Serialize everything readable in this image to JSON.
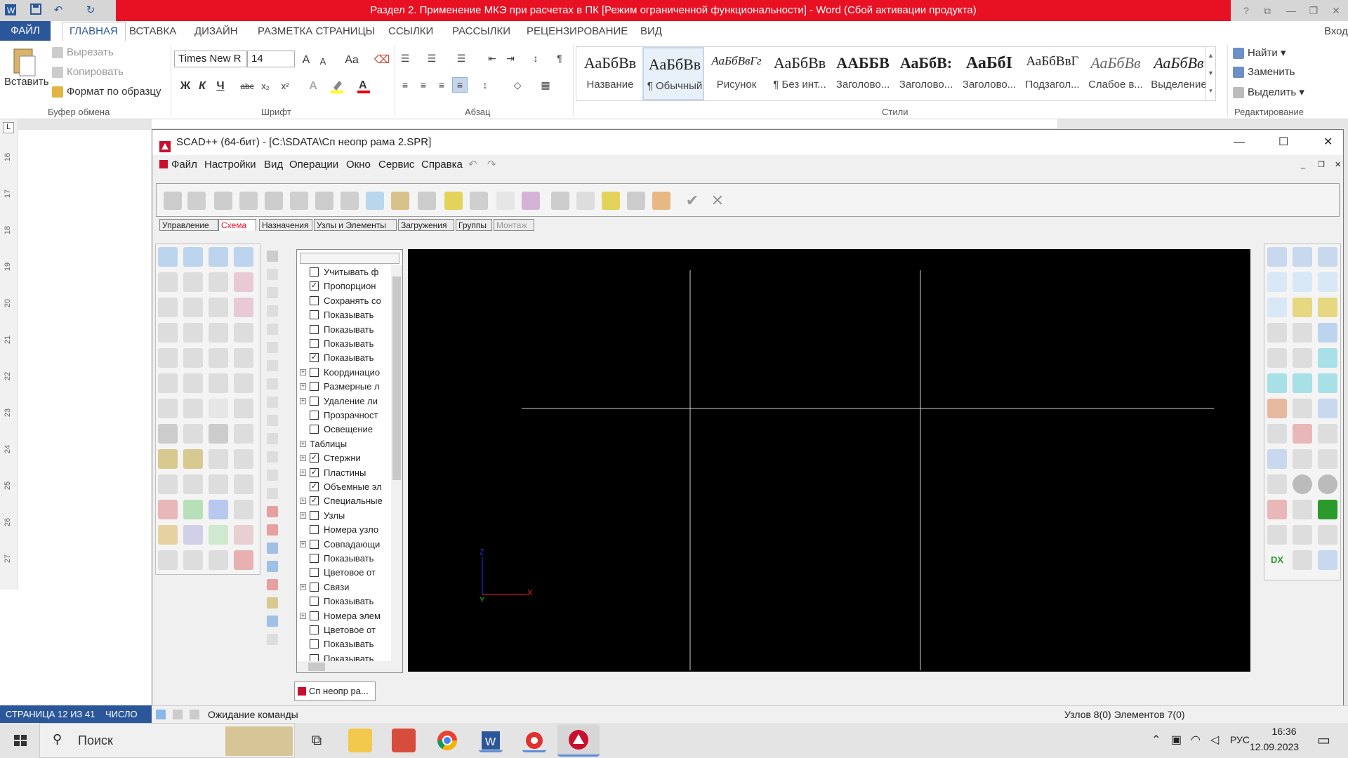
{
  "word": {
    "title": "Раздел 2. Применение МКЭ при расчетах в ПК [Режим ограниченной функциональности] -  Word (Сбой активации продукта)",
    "login": "Вход",
    "tabs": [
      "ФАЙЛ",
      "ГЛАВНАЯ",
      "ВСТАВКА",
      "ДИЗАЙН",
      "РАЗМЕТКА СТРАНИЦЫ",
      "ССЫЛКИ",
      "РАССЫЛКИ",
      "РЕЦЕНЗИРОВАНИЕ",
      "ВИД"
    ],
    "clipboard": {
      "paste": "Вставить",
      "cut": "Вырезать",
      "copy": "Копировать",
      "format": "Формат по образцу",
      "label": "Буфер обмена"
    },
    "font": {
      "name": "Times New R",
      "size": "14",
      "label": "Шрифт",
      "bold": "Ж",
      "italic": "К",
      "underline": "Ч",
      "strike": "abc",
      "sub": "x₂",
      "sup": "x²",
      "grow": "A",
      "shrink": "A",
      "case": "Aa"
    },
    "paragraph": {
      "label": "Абзац"
    },
    "styles": {
      "label": "Стили",
      "items": [
        {
          "preview": "АаБбВв",
          "name": "Название"
        },
        {
          "preview": "АаБбВв",
          "name": "¶ Обычный"
        },
        {
          "preview": "АаБбВвГг",
          "name": "Рисунок"
        },
        {
          "preview": "АаБбВв",
          "name": "¶ Без инт..."
        },
        {
          "preview": "ААББВ",
          "name": "Заголово..."
        },
        {
          "preview": "АаБбВ:",
          "name": "Заголово..."
        },
        {
          "preview": "АаБбІ",
          "name": "Заголово..."
        },
        {
          "preview": "АаБбВвГ",
          "name": "Подзагол..."
        },
        {
          "preview": "АаБбВв",
          "name": "Слабое в..."
        },
        {
          "preview": "АаБбВв",
          "name": "Выделение"
        }
      ]
    },
    "editing": {
      "find": "Найти",
      "replace": "Заменить",
      "select": "Выделить",
      "label": "Редактирование"
    },
    "ruler_numbers": [
      "16",
      "17",
      "18",
      "19",
      "20",
      "21",
      "22",
      "23",
      "24",
      "25",
      "26",
      "27"
    ],
    "status": {
      "page": "СТРАНИЦА 12 ИЗ 41",
      "words": "ЧИСЛО СЛ"
    }
  },
  "scad": {
    "title": "SCAD++ (64-бит) - [C:\\SDATA\\Сп неопр рама 2.SPR]",
    "menu": [
      "Файл",
      "Настройки",
      "Вид",
      "Операции",
      "Окно",
      "Сервис",
      "Справка"
    ],
    "tabs": [
      "Управление",
      "Схема",
      "Назначения",
      "Узлы и Элементы",
      "Загружения",
      "Группы",
      "Монтаж"
    ],
    "tree": [
      {
        "label": "Учитывать ф",
        "checked": false,
        "plus": false
      },
      {
        "label": "Пропорцион",
        "checked": true,
        "plus": false
      },
      {
        "label": "Сохранять со",
        "checked": false,
        "plus": false
      },
      {
        "label": "Показывать",
        "checked": false,
        "plus": false
      },
      {
        "label": "Показывать",
        "checked": false,
        "plus": false
      },
      {
        "label": "Показывать",
        "checked": false,
        "plus": false
      },
      {
        "label": "Показывать",
        "checked": true,
        "plus": false
      },
      {
        "label": "Координацио",
        "checked": false,
        "plus": true
      },
      {
        "label": "Размерные л",
        "checked": false,
        "plus": true
      },
      {
        "label": "Удаление ли",
        "checked": false,
        "plus": true
      },
      {
        "label": "Прозрачност",
        "checked": false,
        "plus": false
      },
      {
        "label": "Освещение",
        "checked": false,
        "plus": false
      },
      {
        "label": "Таблицы",
        "checked": null,
        "plus": true
      },
      {
        "label": "Стержни",
        "checked": true,
        "plus": true
      },
      {
        "label": "Пластины",
        "checked": true,
        "plus": true
      },
      {
        "label": "Объемные эл",
        "checked": true,
        "plus": false
      },
      {
        "label": "Специальные",
        "checked": true,
        "plus": true
      },
      {
        "label": "Узлы",
        "checked": false,
        "plus": true
      },
      {
        "label": "Номера узло",
        "checked": false,
        "plus": false
      },
      {
        "label": "Совпадающи",
        "checked": false,
        "plus": true
      },
      {
        "label": "Показывать",
        "checked": false,
        "plus": false
      },
      {
        "label": "Цветовое от",
        "checked": false,
        "plus": false
      },
      {
        "label": "Связи",
        "checked": false,
        "plus": true
      },
      {
        "label": "Показывать",
        "checked": false,
        "plus": false
      },
      {
        "label": "Номера элем",
        "checked": false,
        "plus": true
      },
      {
        "label": "Цветовое от",
        "checked": false,
        "plus": false
      },
      {
        "label": "Показывать",
        "checked": false,
        "plus": false
      },
      {
        "label": "Показывать",
        "checked": false,
        "plus": false
      }
    ],
    "axes": {
      "z": "Z",
      "x": "X",
      "y": "Y"
    },
    "doc_tab": "Сп неопр ра...",
    "status_left": "Ожидание команды",
    "status_right": "Узлов 8(0) Элементов 7(0)"
  },
  "taskbar": {
    "search": "Поиск",
    "lang": "РУС",
    "time": "16:36",
    "date": "12.09.2023"
  }
}
